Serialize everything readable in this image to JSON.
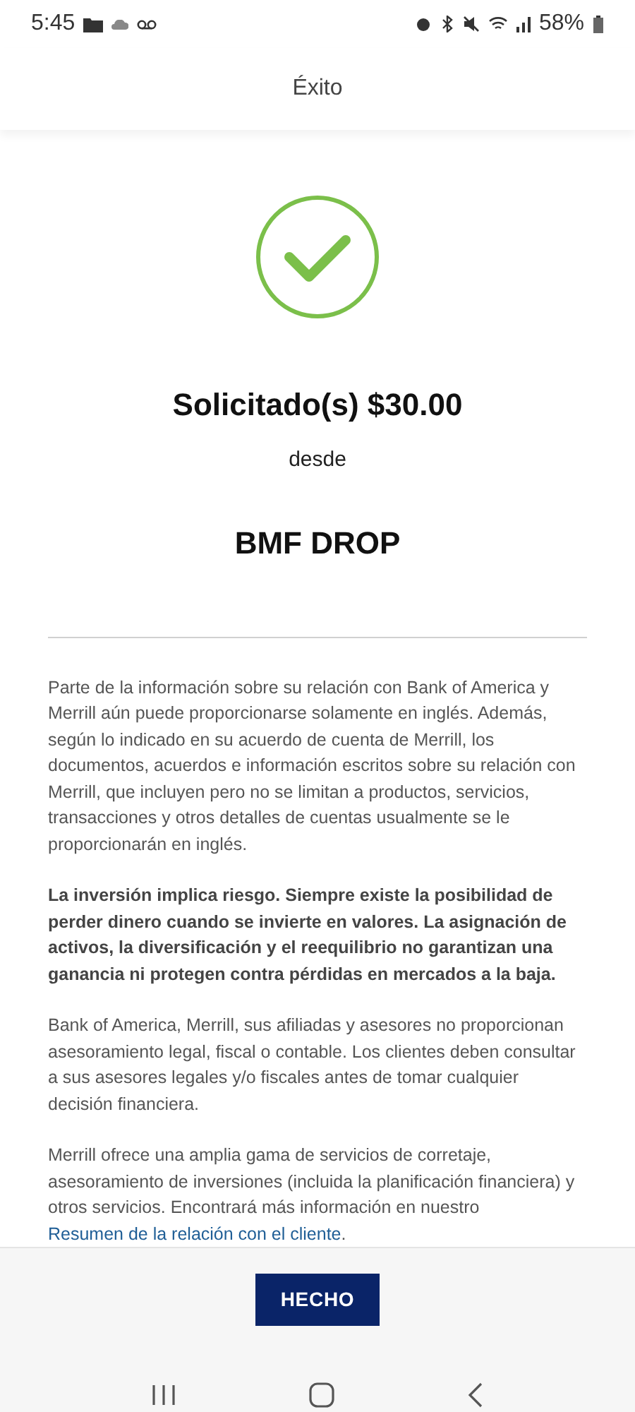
{
  "status_bar": {
    "time": "5:45",
    "battery": "58%"
  },
  "header": {
    "title": "Éxito"
  },
  "result": {
    "title": "Solicitado(s) $30.00",
    "from_label": "desde",
    "source": "BMF DROP"
  },
  "paragraphs": [
    {
      "kind": "plain",
      "text": "Parte de la información sobre su relación con Bank of America y Merrill aún puede proporcionarse solamente en inglés. Además, según lo indicado en su acuerdo de cuenta de Merrill, los documentos, acuerdos e información escritos sobre su relación con Merrill, que incluyen pero no se limitan a productos, servicios, transacciones y otros detalles de cuentas usualmente se le proporcionarán en inglés."
    },
    {
      "kind": "bold",
      "text": "La inversión implica riesgo. Siempre existe la posibilidad de perder dinero cuando se invierte en valores. La asignación de activos, la diversificación y el reequilibrio no garantizan una ganancia ni protegen contra pérdidas en mercados a la baja."
    },
    {
      "kind": "plain",
      "text": "Bank of America, Merrill, sus afiliadas y asesores no proporcionan asesoramiento legal, fiscal o contable. Los clientes deben consultar a sus asesores legales y/o fiscales antes de tomar cualquier decisión financiera."
    },
    {
      "kind": "link",
      "text": "Merrill ofrece una amplia gama de servicios de corretaje, asesoramiento de inversiones (incluida la planificación financiera) y otros servicios. Encontrará más información en nuestro",
      "link": "Resumen de la relación con el cliente",
      "after": "."
    }
  ],
  "done_button": "HECHO"
}
